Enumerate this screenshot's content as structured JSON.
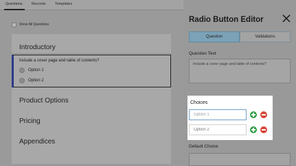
{
  "tabs": {
    "questions": "Questions",
    "records": "Records",
    "templates": "Templates"
  },
  "show_all": {
    "label": "Show All Questions"
  },
  "sections": {
    "intro": "Introductory",
    "product": "Product Options",
    "pricing": "Pricing",
    "appendices": "Appendices"
  },
  "question": {
    "text": "Include a cover page and table of contents?",
    "options": [
      "Option 1",
      "Option 2"
    ]
  },
  "editor": {
    "title": "Radio Button Editor",
    "seg_question": "Question",
    "seg_validations": "Validations",
    "question_text_label": "Question Text",
    "question_text_value": "Include a cover page and table of contents?",
    "choices_label": "Choices",
    "choice_1_value": "Option 1",
    "choice_2_placeholder": "Option 2",
    "default_choice_label": "Default Choice"
  },
  "colors": {
    "accent": "#7ba2b7",
    "add": "#33a04a",
    "remove": "#d8473a"
  }
}
